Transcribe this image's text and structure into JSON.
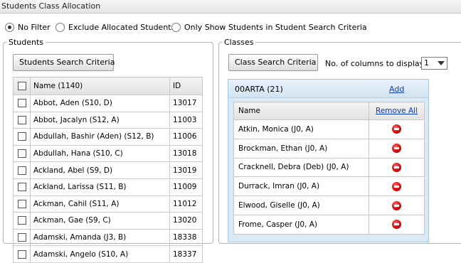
{
  "window": {
    "title": "Students Class Allocation"
  },
  "filters": [
    {
      "label": "No Filter",
      "checked": true
    },
    {
      "label": "Exclude Allocated Students",
      "checked": false
    },
    {
      "label": "Only Show Students in Student Search Criteria",
      "checked": false
    }
  ],
  "students": {
    "group_label": "Students",
    "search_button": "Students Search Criteria",
    "columns": {
      "name": "Name (1140)",
      "id": "ID"
    },
    "rows": [
      {
        "name": "Abbot, Aden (S10, D)",
        "id": "13017"
      },
      {
        "name": "Abbot, Jacalyn (S12, A)",
        "id": "11003"
      },
      {
        "name": "Abdullah, Bashir (Aden) (S12, B)",
        "id": "11006"
      },
      {
        "name": "Abdullah, Hana (S10, C)",
        "id": "13018"
      },
      {
        "name": "Ackland, Abel (S9, D)",
        "id": "13019"
      },
      {
        "name": "Ackland, Larissa (S11, B)",
        "id": "11009"
      },
      {
        "name": "Ackman, Cahil (S11, A)",
        "id": "11012"
      },
      {
        "name": "Ackman, Gae (S9, C)",
        "id": "13020"
      },
      {
        "name": "Adamski, Amanda (J3, B)",
        "id": "18338"
      },
      {
        "name": "Adamski, Angelo (S10, A)",
        "id": "18337"
      }
    ]
  },
  "classes": {
    "group_label": "Classes",
    "search_button": "Class Search Criteria",
    "columns_label": "No. of columns to display:",
    "columns_value": "1",
    "class_panel": {
      "name": "00ARTA (21)",
      "add_label": "Add",
      "name_header": "Name",
      "remove_all_label": "Remove All",
      "rows": [
        "Atkin, Monica (J0, A)",
        "Brockman, Ethan (J0, A)",
        "Cracknell, Debra (Deb) (J0, A)",
        "Durrack, Imran (J0, A)",
        "Elwood, Giselle (J0, A)",
        "Frome, Casper (J0, A)"
      ]
    }
  }
}
